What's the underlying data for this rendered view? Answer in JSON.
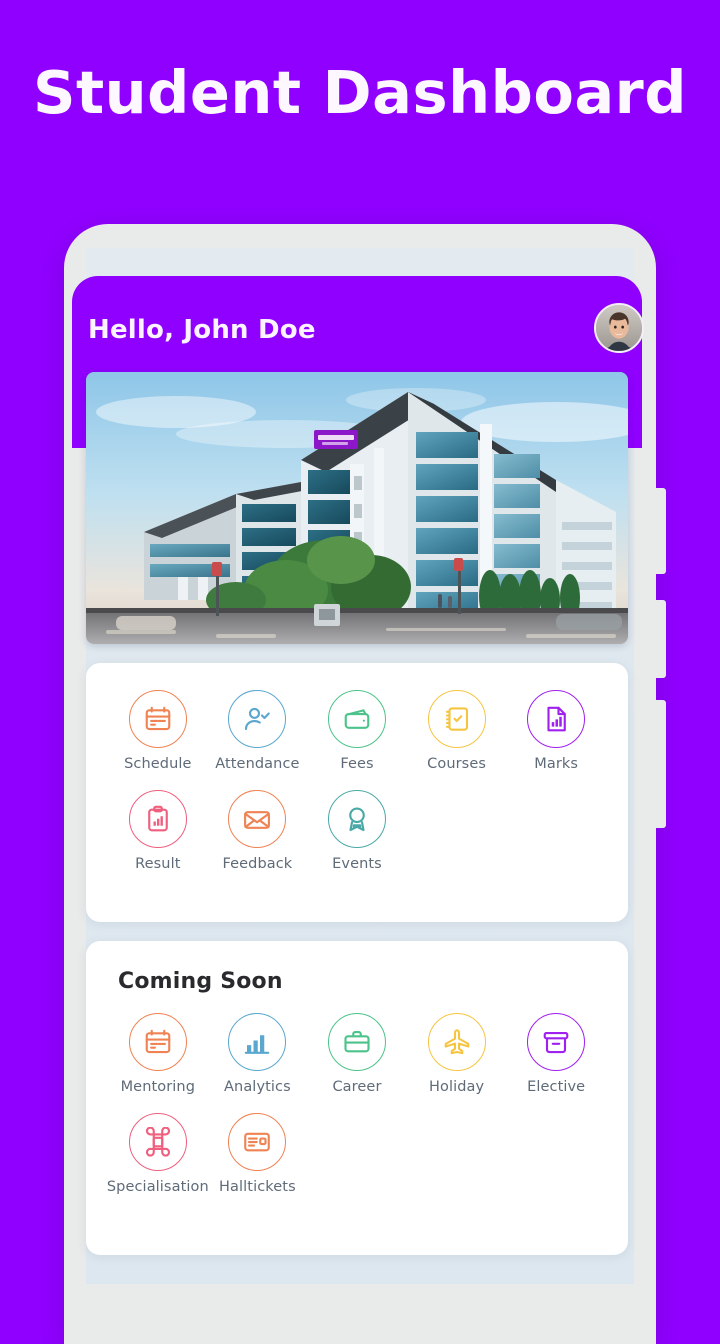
{
  "page": {
    "title": "Student Dashboard",
    "background_color": "#9000ff"
  },
  "phone": {
    "screen_background": "#dfe8ef",
    "frame_color": "#e9eaea"
  },
  "header": {
    "greeting": "Hello, John Doe",
    "avatar_alt": "user-avatar",
    "background_color": "#9000ff"
  },
  "banner": {
    "alt": "campus-building-photo"
  },
  "apps_card": {
    "items": [
      {
        "label": "Schedule",
        "icon": "calendar-icon",
        "color": "#ef8354"
      },
      {
        "label": "Attendance",
        "icon": "user-check-icon",
        "color": "#5ba7cf"
      },
      {
        "label": "Fees",
        "icon": "wallet-icon",
        "color": "#4cc38a"
      },
      {
        "label": "Courses",
        "icon": "checklist-icon",
        "color": "#f5c542"
      },
      {
        "label": "Marks",
        "icon": "chart-document-icon",
        "color": "#a020f0"
      },
      {
        "label": "Result",
        "icon": "clipboard-chart-icon",
        "color": "#ef5f7e"
      },
      {
        "label": "Feedback",
        "icon": "envelope-icon",
        "color": "#ef8354"
      },
      {
        "label": "Events",
        "icon": "award-ribbon-icon",
        "color": "#4aa9a6"
      }
    ]
  },
  "coming_soon_card": {
    "title": "Coming Soon",
    "items": [
      {
        "label": "Specialisation",
        "icon": "command-icon",
        "color": "#ef5f7e"
      },
      {
        "label": "Halltickets",
        "icon": "id-card-icon",
        "color": "#ef8354"
      }
    ],
    "items_row1": [
      {
        "label": "Mentoring",
        "icon": "calendar-icon",
        "color": "#ef8354"
      },
      {
        "label": "Analytics",
        "icon": "bar-chart-icon",
        "color": "#5ba7cf"
      },
      {
        "label": "Career",
        "icon": "briefcase-icon",
        "color": "#4cc38a"
      },
      {
        "label": "Holiday",
        "icon": "airplane-icon",
        "color": "#f5c542"
      },
      {
        "label": "Elective",
        "icon": "archive-box-icon",
        "color": "#a020f0"
      }
    ]
  }
}
